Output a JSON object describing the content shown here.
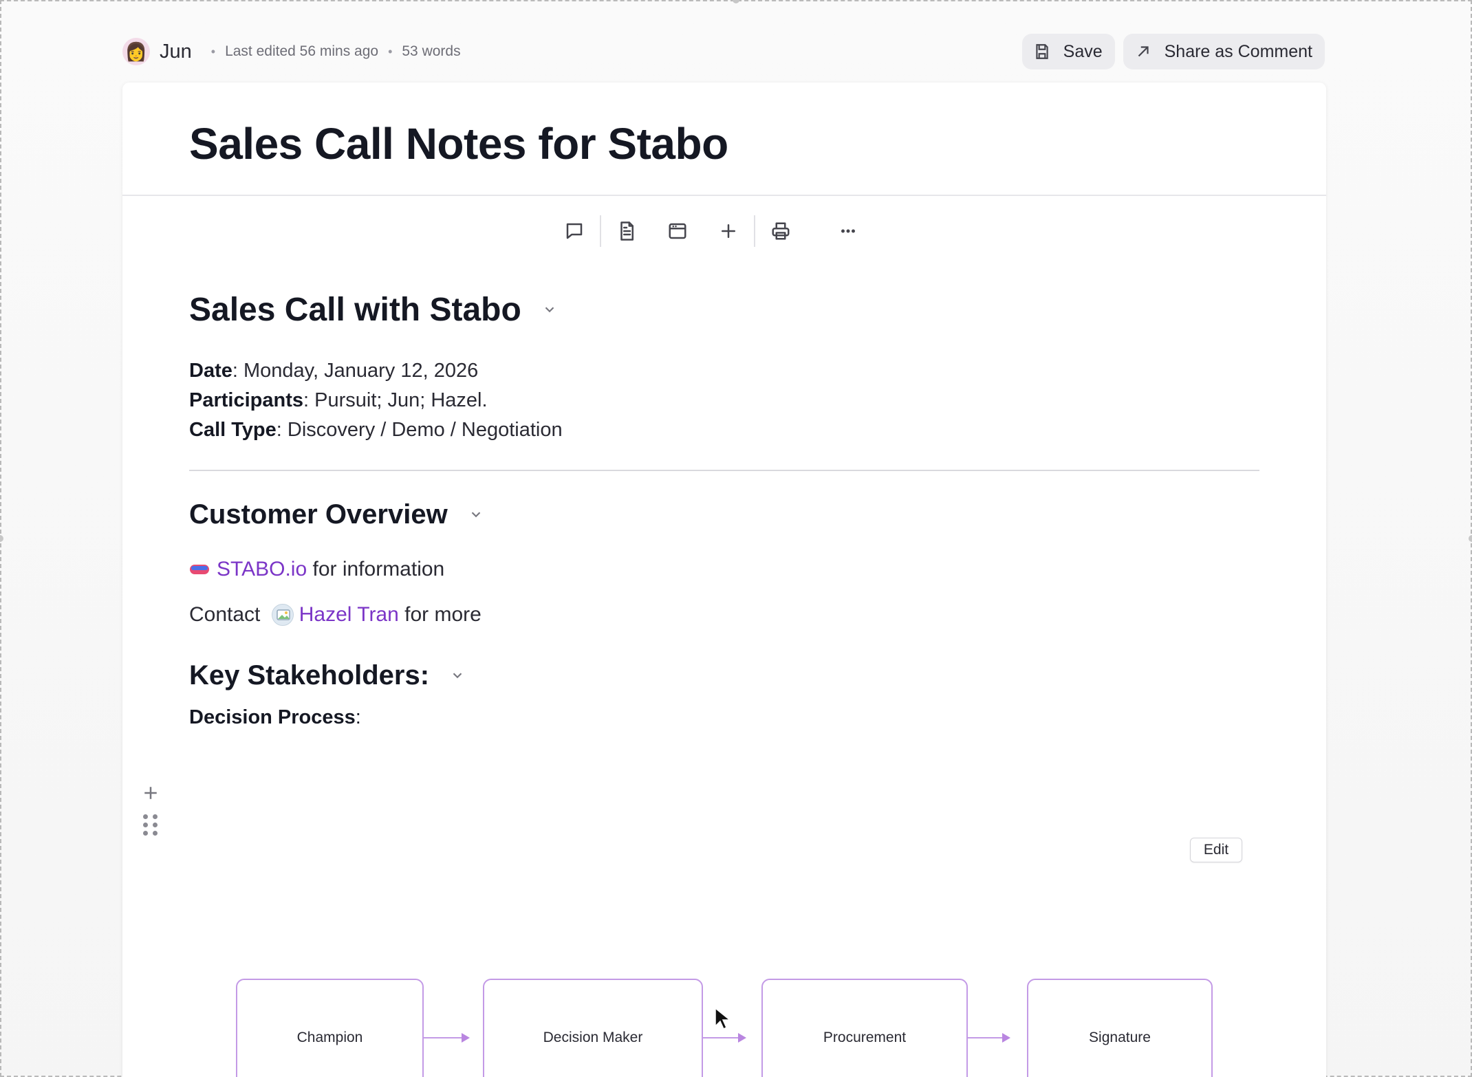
{
  "header": {
    "user_name": "Jun",
    "last_edited": "Last edited 56 mins ago",
    "word_count": "53 words",
    "save_label": "Save",
    "share_label": "Share as Comment"
  },
  "document": {
    "title": "Sales Call Notes for Stabo",
    "section_title": "Sales Call with Stabo",
    "meta": [
      {
        "label": "Date",
        "value": ": Monday, January 12, 2026"
      },
      {
        "label": "Participants",
        "value": ": Pursuit; Jun; Hazel."
      },
      {
        "label": "Call Type",
        "value": ": Discovery / Demo / Negotiation"
      }
    ],
    "customer_overview": {
      "heading": "Customer Overview",
      "link_text": "STABO.io",
      "link_suffix": " for information",
      "contact_prefix": "Contact ",
      "contact_name": "Hazel Tran",
      "contact_suffix": " for more"
    },
    "stakeholders": {
      "heading": "Key Stakeholders:",
      "decision_label": "Decision Process",
      "decision_suffix": ":"
    }
  },
  "diagram": {
    "edit_label": "Edit",
    "nodes": [
      "Champion",
      "Decision Maker",
      "Procurement",
      "Signature"
    ]
  },
  "icons": {
    "toolbar": [
      "comment-icon",
      "document-icon",
      "window-icon",
      "plus-icon",
      "print-icon",
      "more-icon"
    ]
  },
  "colors": {
    "accent": "#7b35c7",
    "node_border": "#c39ae6"
  }
}
